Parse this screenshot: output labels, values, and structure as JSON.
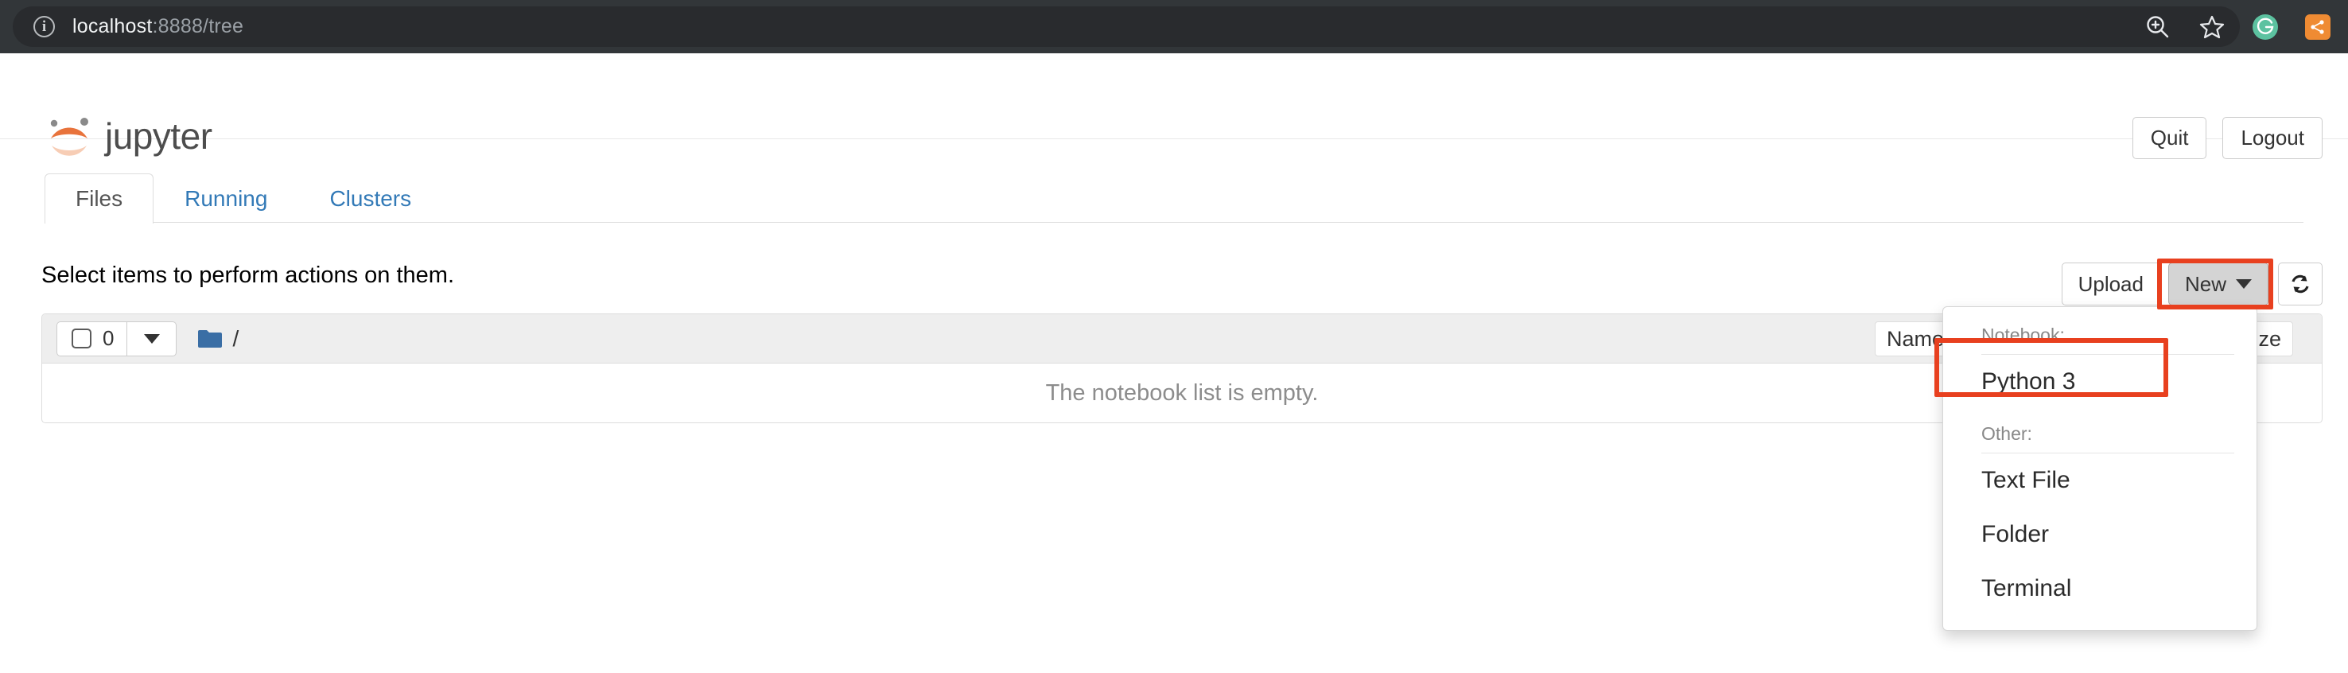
{
  "browser": {
    "url_host": "localhost",
    "url_path": ":8888/tree",
    "info_icon": "info-icon",
    "actions": [
      {
        "name": "zoom-in-icon",
        "label": ""
      },
      {
        "name": "bookmark-star-icon",
        "label": ""
      },
      {
        "name": "grammarly-extension-icon",
        "label": "G"
      },
      {
        "name": "share-extension-icon",
        "label": ""
      }
    ]
  },
  "header": {
    "logo_text": "jupyter",
    "quit_label": "Quit",
    "logout_label": "Logout"
  },
  "tabs": [
    {
      "label": "Files",
      "active": true
    },
    {
      "label": "Running",
      "active": false
    },
    {
      "label": "Clusters",
      "active": false
    }
  ],
  "toolbar": {
    "select_note": "Select items to perform actions on them.",
    "upload_label": "Upload",
    "new_label": "New",
    "refresh_icon": "refresh-icon"
  },
  "filelist": {
    "selected_count": "0",
    "breadcrumb_root": "/",
    "folder_icon": "folder-icon",
    "sort_name_label": "Name",
    "sort_size_label": "File size",
    "empty_message": "The notebook list is empty."
  },
  "dropdown": {
    "notebook_label": "Notebook:",
    "notebook_items": [
      "Python 3"
    ],
    "other_label": "Other:",
    "other_items": [
      "Text File",
      "Folder",
      "Terminal"
    ]
  },
  "colors": {
    "annotation": "#e8401f",
    "jupyter_orange": "#e8733c",
    "link_blue": "#337ab7",
    "folder_blue": "#3a6ea5",
    "chrome_bg": "#323639"
  }
}
